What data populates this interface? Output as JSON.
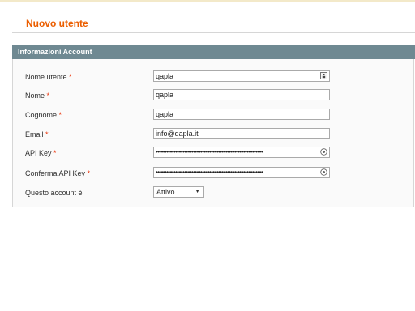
{
  "page": {
    "title": "Nuovo utente"
  },
  "fieldset": {
    "title": "Informazioni Account"
  },
  "form": {
    "username": {
      "label": "Nome utente",
      "required": "*",
      "value": "qapla"
    },
    "firstname": {
      "label": "Nome",
      "required": "*",
      "value": "qapla"
    },
    "lastname": {
      "label": "Cognome",
      "required": "*",
      "value": "qapla"
    },
    "email": {
      "label": "Email",
      "required": "*",
      "value": "info@qapla.it"
    },
    "api_key": {
      "label": "API Key",
      "required": "*",
      "value": "••••••••••••••••••••••••••••••••••••••••••••••••••••••••••••"
    },
    "api_key_confirm": {
      "label": "Conferma API Key",
      "required": "*",
      "value": "••••••••••••••••••••••••••••••••••••••••••••••••••••••••••••"
    },
    "is_active": {
      "label": "Questo account è",
      "selected": "Attivo"
    }
  },
  "icons": {
    "username_field": "contact-card-icon",
    "api_key_field": "reveal-password-icon",
    "api_key_confirm_field": "reveal-password-icon",
    "select_arrow": "chevron-down-icon"
  },
  "colors": {
    "title": "#eb5e00",
    "fieldset_header": "#6f8992",
    "required": "#eb340a"
  }
}
